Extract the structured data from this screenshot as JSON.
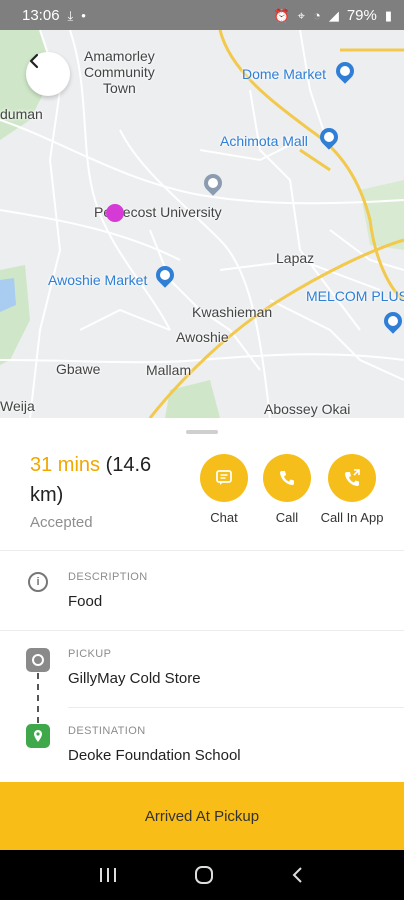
{
  "status_bar": {
    "time": "13:06",
    "battery": "79%"
  },
  "map": {
    "labels": {
      "amamorley": "Amamorley\nCommunity\nTown",
      "duman": "duman",
      "dome_market": "Dome Market",
      "achimota_mall": "Achimota Mall",
      "pentecost": "Pentecost University",
      "awoshie_market": "Awoshie Market",
      "lapaz": "Lapaz",
      "melcom": "MELCOM PLUS",
      "kwashieman": "Kwashieman",
      "awoshie": "Awoshie",
      "gbawe": "Gbawe",
      "mallam": "Mallam",
      "weija": "Weija",
      "abossey": "Abossey Okai"
    }
  },
  "trip": {
    "eta_time": "31 mins",
    "eta_distance": " (14.6 km)",
    "status": "Accepted"
  },
  "actions": {
    "chat": "Chat",
    "call": "Call",
    "call_in_app": "Call In App"
  },
  "details": {
    "description_label": "DESCRIPTION",
    "description_value": "Food",
    "pickup_label": "PICKUP",
    "pickup_value": "GillyMay Cold Store",
    "destination_label": "DESTINATION",
    "destination_value": "Deoke Foundation School"
  },
  "primary_action": "Arrived At Pickup",
  "colors": {
    "accent": "#f6be1a",
    "eta": "#f0a800",
    "destination": "#3ea84a"
  },
  "icons": [
    "back-arrow-icon",
    "chat-icon",
    "phone-icon",
    "phone-app-icon",
    "info-icon",
    "pickup-icon",
    "destination-pin-icon"
  ]
}
